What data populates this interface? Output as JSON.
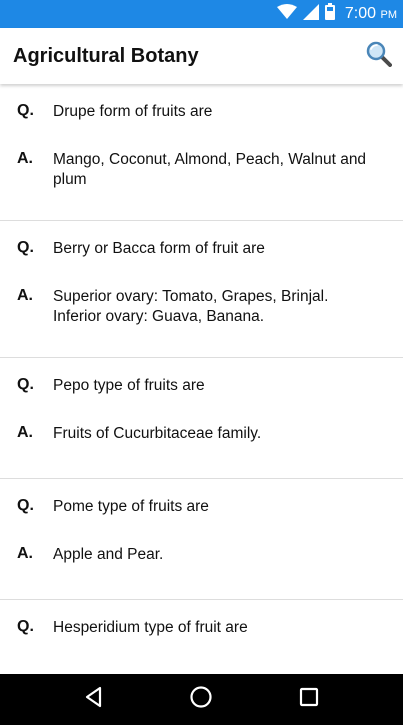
{
  "status_bar": {
    "time": "7:00",
    "ampm": "PM",
    "icons": [
      "wifi-icon",
      "cell-signal-icon",
      "battery-icon"
    ]
  },
  "app_bar": {
    "title": "Agricultural Botany",
    "search_icon": "search-icon"
  },
  "qa_list": [
    {
      "q_marker": "Q.",
      "question": "Drupe form of fruits are",
      "a_marker": "A.",
      "answer": "Mango, Coconut, Almond, Peach, Walnut and plum"
    },
    {
      "q_marker": "Q.",
      "question": "Berry or Bacca form of fruit are",
      "a_marker": "A.",
      "answer": "Superior ovary: Tomato, Grapes, Brinjal.\nInferior ovary: Guava, Banana."
    },
    {
      "q_marker": "Q.",
      "question": "Pepo type of fruits are",
      "a_marker": "A.",
      "answer": "Fruits of Cucurbitaceae family."
    },
    {
      "q_marker": "Q.",
      "question": "Pome type of fruits are",
      "a_marker": "A.",
      "answer": "Apple and Pear."
    },
    {
      "q_marker": "Q.",
      "question": "Hesperidium type of fruit are"
    }
  ],
  "nav_bar": {
    "buttons": [
      "back-icon",
      "home-icon",
      "recents-icon"
    ]
  },
  "colors": {
    "status_bar": "#1e88e5",
    "divider": "#dddddd",
    "nav_bar": "#000000"
  }
}
